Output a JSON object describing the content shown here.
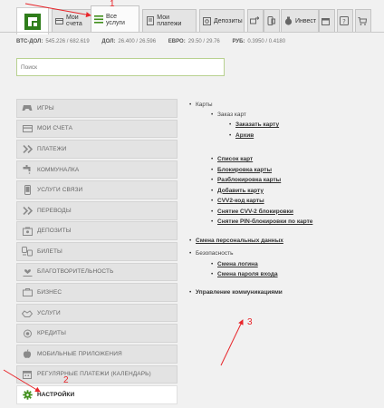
{
  "nav": {
    "tabs": [
      {
        "label": "Мои счета",
        "icon": "card-icon"
      },
      {
        "label": "Все услуги",
        "icon": "list-icon"
      },
      {
        "label": "Мои платежи",
        "icon": "doc-icon"
      },
      {
        "label": "Депозиты",
        "icon": "safe-icon"
      },
      {
        "label": "",
        "icon": "transfer-icon"
      },
      {
        "label": "",
        "icon": "phone-icon"
      },
      {
        "label": "Инвест",
        "icon": "moneybag-icon"
      },
      {
        "label": "",
        "icon": "calendar-icon"
      },
      {
        "label": "",
        "icon": "help-icon"
      },
      {
        "label": "",
        "icon": "cart-icon"
      }
    ],
    "active_tab": "Все услуги"
  },
  "balances": [
    {
      "name": "BTC-ДОЛ:",
      "value": "545.226 / 682.619"
    },
    {
      "name": "ДОЛ:",
      "value": "26.400 / 26.596"
    },
    {
      "name": "ЕВРО:",
      "value": "29.50 / 29.76"
    },
    {
      "name": "РУБ:",
      "value": "0.3950 / 0.4180"
    }
  ],
  "search": {
    "placeholder": "Поиск"
  },
  "menu": {
    "items": [
      {
        "label": "ИГРЫ",
        "icon": "gamepad-icon"
      },
      {
        "label": "МОИ СЧЕТА",
        "icon": "card-icon"
      },
      {
        "label": "ПЛАТЕЖИ",
        "icon": "double-chevron-icon"
      },
      {
        "label": "КОММУНАЛКА",
        "icon": "faucet-icon"
      },
      {
        "label": "УСЛУГИ СВЯЗИ",
        "icon": "mobile-icon"
      },
      {
        "label": "ПЕРЕВОДЫ",
        "icon": "double-chevron-icon"
      },
      {
        "label": "ДЕПОЗИТЫ",
        "icon": "piggy-bank-icon"
      },
      {
        "label": "БИЛЕТЫ",
        "icon": "transport-icon"
      },
      {
        "label": "БЛАГОТВОРИТЕЛЬНОСТЬ",
        "icon": "heart-hands-icon"
      },
      {
        "label": "БИЗНЕС",
        "icon": "briefcase-icon"
      },
      {
        "label": "УСЛУГИ",
        "icon": "hands-icon"
      },
      {
        "label": "КРЕДИТЫ",
        "icon": "coins-icon"
      },
      {
        "label": "МОБИЛЬНЫЕ ПРИЛОЖЕНИЯ",
        "icon": "apple-icon"
      },
      {
        "label": "РЕГУЛЯРНЫЕ ПЛАТЕЖИ (КАЛЕНДАРЬ)",
        "icon": "calendar-icon"
      },
      {
        "label": "НАСТРОЙКИ",
        "icon": "gear-icon"
      }
    ],
    "active": "НАСТРОЙКИ"
  },
  "settings": {
    "cards_title": "Карты",
    "order_title": "Заказ карт",
    "order_card": "Заказать карту",
    "archive": "Архив",
    "card_links": [
      "Список карт",
      "Блокировка карты",
      "Разблокировка карты",
      "Добавить карту",
      "CVV2-код карты",
      "Снятие CVV-2 блокировки",
      "Снятие PIN-блокировки по карте"
    ],
    "change_personal": "Смена персональных данных",
    "security_title": "Безопасность",
    "security_links": [
      "Смена логина",
      "Смена пароля входа"
    ],
    "communications": "Управление коммуникациями"
  },
  "annotations": {
    "one": "1",
    "two": "2",
    "three": "3"
  },
  "colors": {
    "accent_green": "#4a8f1e",
    "annotation_red": "#e8252a"
  }
}
